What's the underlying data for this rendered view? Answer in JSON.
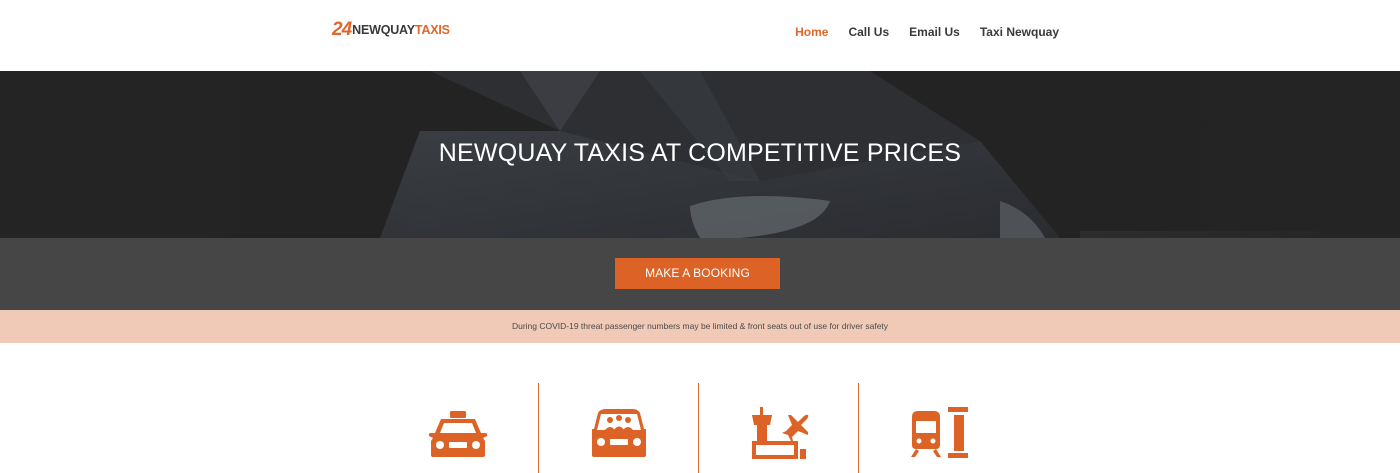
{
  "header": {
    "logo": {
      "number": "24",
      "part_a": "NEWQUAY",
      "part_b": "TAXIS"
    },
    "nav": [
      {
        "label": "Home",
        "active": true
      },
      {
        "label": "Call Us",
        "active": false
      },
      {
        "label": "Email Us",
        "active": false
      },
      {
        "label": "Taxi Newquay",
        "active": false
      }
    ]
  },
  "hero": {
    "title": "NEWQUAY TAXIS AT COMPETITIVE PRICES"
  },
  "booking": {
    "button_label": "MAKE A BOOKING"
  },
  "notice": {
    "text": "During COVID-19 threat passenger numbers may be limited & front seats out of use for driver safety"
  },
  "services": {
    "icons": [
      "taxi-icon",
      "minibus-icon",
      "airport-icon",
      "train-station-icon"
    ]
  },
  "colors": {
    "accent": "#dd6226",
    "hero_bg": "#242424",
    "band_bg": "#464646",
    "notice_bg": "#f0cab7"
  }
}
